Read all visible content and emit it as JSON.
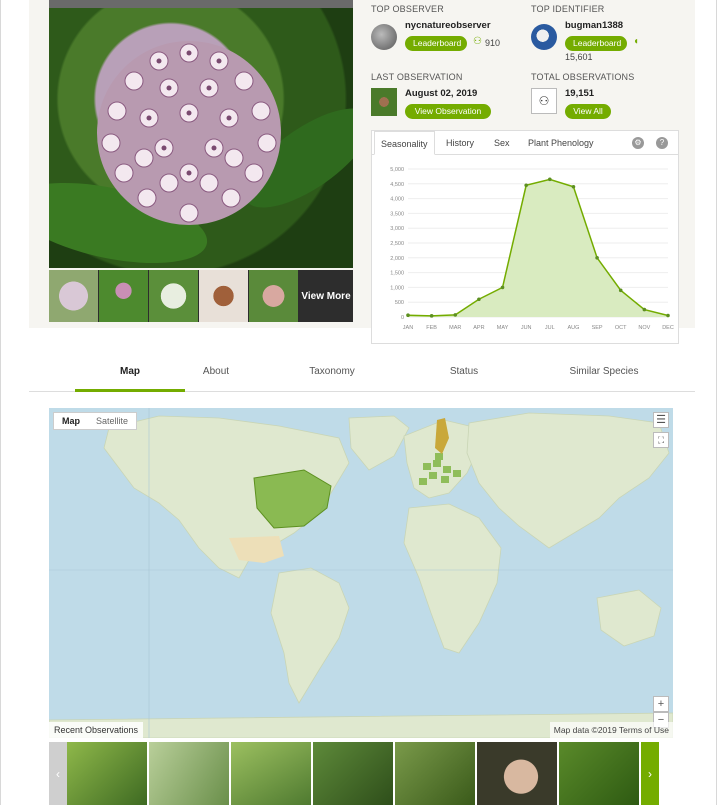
{
  "photo": {
    "view_more": "View More"
  },
  "top_observer": {
    "label": "TOP OBSERVER",
    "name": "nycnatureobserver",
    "button": "Leaderboard",
    "count": "910"
  },
  "top_identifier": {
    "label": "TOP IDENTIFIER",
    "name": "bugman1388",
    "button": "Leaderboard",
    "count": "15,601"
  },
  "last_observation": {
    "label": "LAST OBSERVATION",
    "date": "August 02, 2019",
    "button": "View Observation"
  },
  "total_observations": {
    "label": "TOTAL OBSERVATIONS",
    "count": "19,151",
    "button": "View All"
  },
  "chart_tabs": [
    "Seasonality",
    "History",
    "Sex",
    "Plant Phenology"
  ],
  "nav": [
    "Map",
    "About",
    "Taxonomy",
    "Status",
    "Similar Species"
  ],
  "map": {
    "toggle_map": "Map",
    "toggle_satellite": "Satellite",
    "recent": "Recent Observations",
    "attribution": "Map data ©2019  Terms of Use",
    "zoom_in": "+",
    "zoom_out": "−"
  },
  "colors": {
    "accent": "#74ac00",
    "map_water": "#bfdbe8",
    "map_land": "#dfe8cf",
    "range_fill": "#7bb13c"
  },
  "chart_data": {
    "type": "area",
    "x": [
      "JAN",
      "FEB",
      "MAR",
      "APR",
      "MAY",
      "JUN",
      "JUL",
      "AUG",
      "SEP",
      "OCT",
      "NOV",
      "DEC"
    ],
    "y_ticks": [
      "5,000",
      "4,500",
      "4,000",
      "3,500",
      "3,000",
      "2,500",
      "2,000",
      "1,500",
      "1,000",
      "500",
      "0"
    ],
    "ylim": [
      0,
      5000
    ],
    "series": [
      {
        "values": [
          60,
          40,
          70,
          600,
          1000,
          4450,
          4650,
          4400,
          2000,
          900,
          250,
          50
        ]
      }
    ],
    "grid": true
  }
}
